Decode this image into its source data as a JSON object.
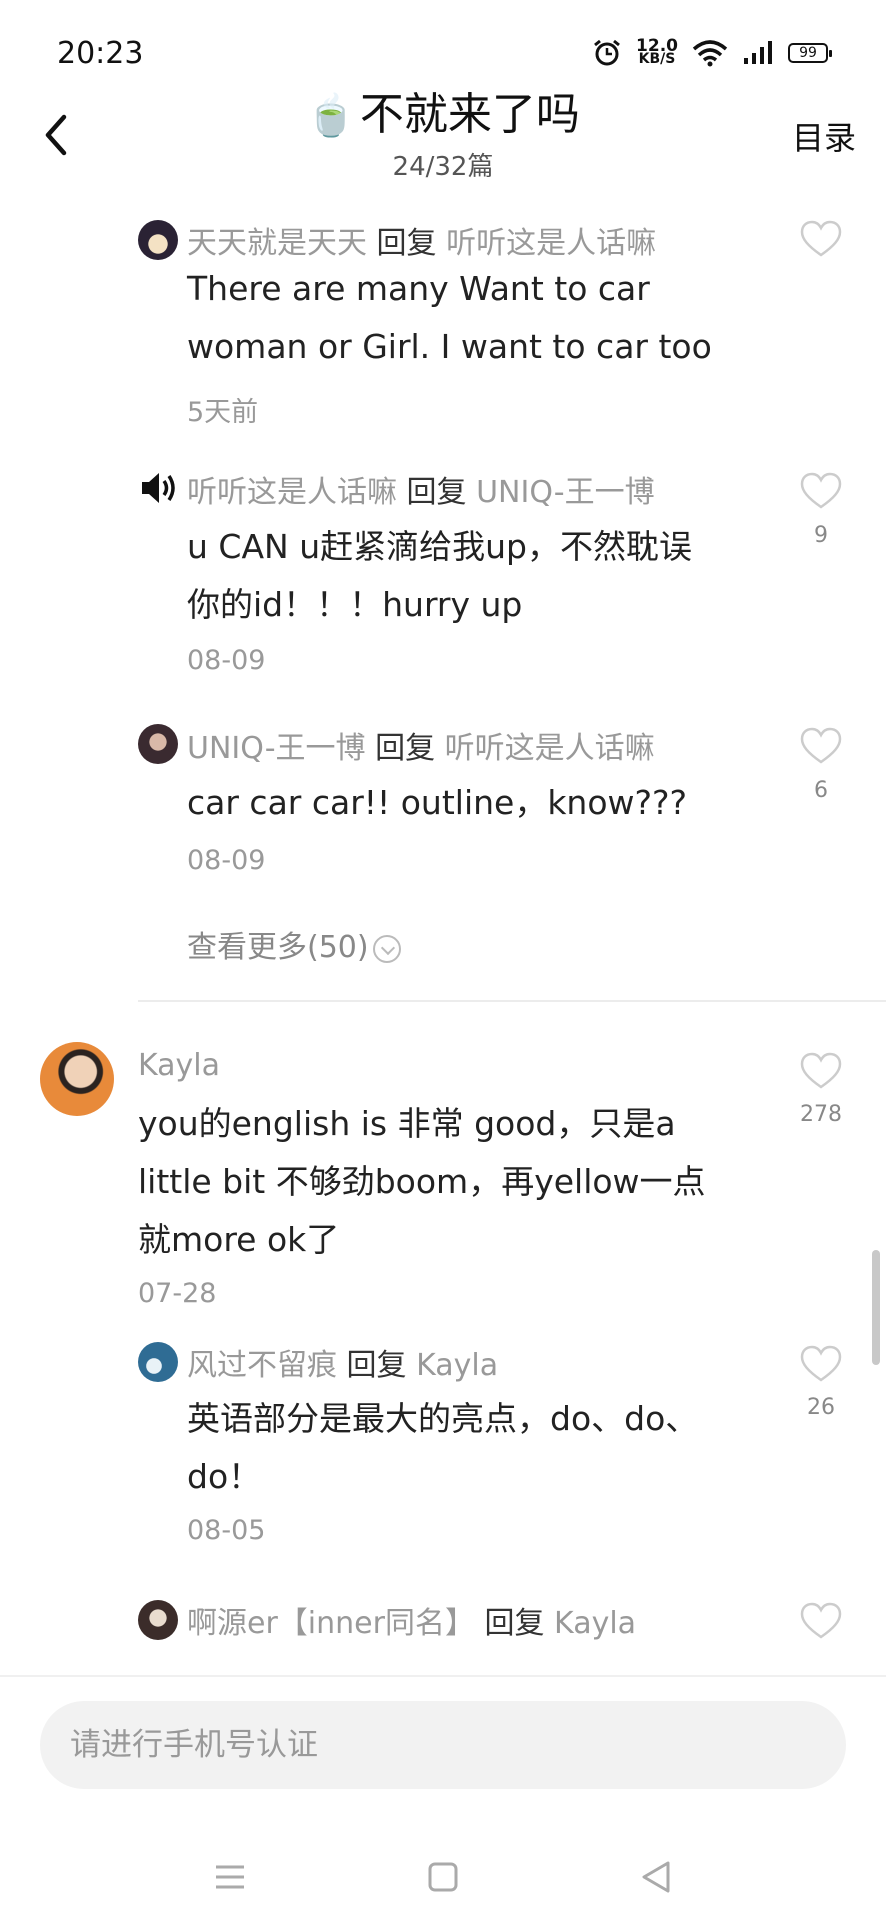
{
  "status_bar": {
    "time": "20:23",
    "net_speed_value": "12.0",
    "net_speed_unit": "KB/S",
    "battery": "99"
  },
  "header": {
    "title": "不就来了吗",
    "subtitle": "24/32篇",
    "toc_label": "目录"
  },
  "comments": [
    {
      "user": "天天就是天天",
      "reply_word": "回复",
      "reply_to": "听听这是人话嘛",
      "text_lines": [
        "There are many Want to car",
        "woman or Girl. I want to car too"
      ],
      "date": "5天前",
      "likes": ""
    },
    {
      "user": "听听这是人话嘛",
      "reply_word": "回复",
      "reply_to": "UNIQ-王一博",
      "text_lines": [
        "u CAN u赶紧滴给我up，不然耽误",
        "你的id！！！hurry up"
      ],
      "date": "08-09",
      "likes": "9"
    },
    {
      "user": "UNIQ-王一博",
      "reply_word": "回复",
      "reply_to": "听听这是人话嘛",
      "text_lines": [
        "car car car!! outline，know???"
      ],
      "date": "08-09",
      "likes": "6"
    },
    {
      "user": "Kayla",
      "text_lines": [
        "you的english is 非常 good，只是a",
        "little bit 不够劲boom，再yellow一点",
        "就more ok了"
      ],
      "date": "07-28",
      "likes": "278"
    },
    {
      "user": "风过不留痕",
      "reply_word": "回复",
      "reply_to": "Kayla",
      "text_lines": [
        "英语部分是最大的亮点，do、do、",
        "do！"
      ],
      "date": "08-05",
      "likes": "26"
    },
    {
      "user": "啊源er【inner同名】",
      "reply_word": "回复",
      "reply_to": "Kayla"
    }
  ],
  "view_more_label": "查看更多(50)",
  "input": {
    "placeholder": "请进行手机号认证"
  },
  "colors": {
    "text": "#222222",
    "meta": "#999999",
    "input_bg": "#f2f2f2"
  }
}
